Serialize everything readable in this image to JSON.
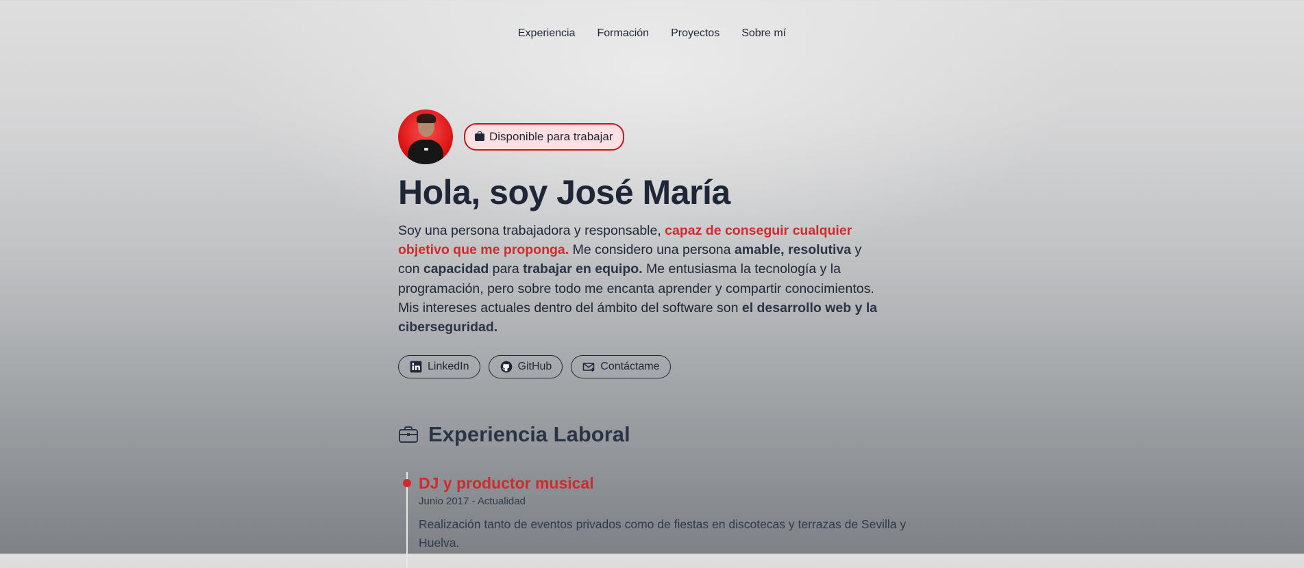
{
  "nav": {
    "items": [
      {
        "label": "Experiencia"
      },
      {
        "label": "Formación"
      },
      {
        "label": "Proyectos"
      },
      {
        "label": "Sobre mí"
      }
    ]
  },
  "badge": {
    "label": "Disponible para trabajar",
    "icon": "briefcase-icon"
  },
  "hero": {
    "title": "Hola, soy José María",
    "intro": {
      "t1": "Soy una persona trabajadora y responsable, ",
      "h1": "capaz de conseguir cualquier objetivo que me proponga.",
      "t2": " Me considero una persona ",
      "b1": "amable, resolutiva",
      "t3": " y con ",
      "b2": "capacidad",
      "t4": " para ",
      "b3": "trabajar en equipo.",
      "t5": " Me entusiasma la tecnología y la programación, pero sobre todo me encanta aprender y compartir conocimientos. Mis intereses actuales dentro del ámbito del software son ",
      "b4": "el desarrollo web y la ciberseguridad."
    }
  },
  "social": [
    {
      "label": "LinkedIn",
      "icon": "linkedin-icon"
    },
    {
      "label": "GitHub",
      "icon": "github-icon"
    },
    {
      "label": "Contáctame",
      "icon": "mail-icon"
    }
  ],
  "experience": {
    "title": "Experiencia Laboral",
    "icon": "briefcase-icon",
    "items": [
      {
        "title": "DJ y productor musical",
        "date": "Junio 2017 - Actualidad",
        "description": "Realización tanto de eventos privados como de fiestas en discotecas y terrazas de Sevilla y Huelva."
      }
    ]
  },
  "colors": {
    "accent": "#d12a2d",
    "text": "#1f2637",
    "badge_bg": "#fde1e2"
  }
}
